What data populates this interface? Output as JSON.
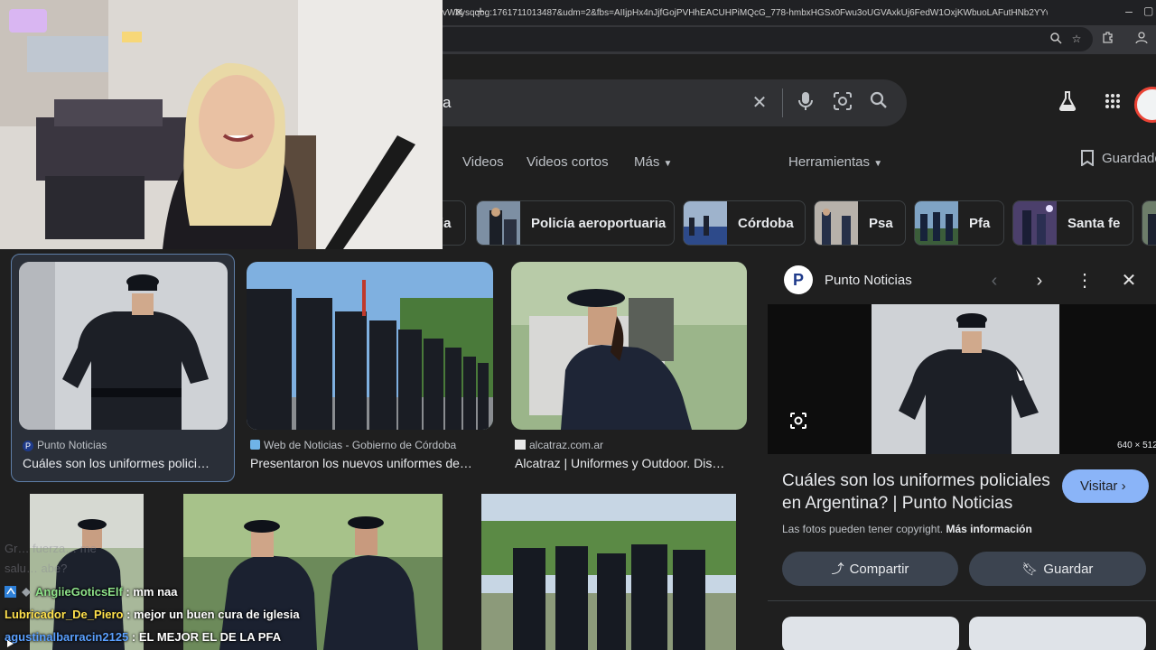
{
  "browser": {
    "url": "vW0ysqqog:1761711013487&udm=2&fbs=AIIjpHx4nJjfGojPVHhEACUHPiMQcG_778-hmbxHGSx0Fwu3oUGVAxkUj6FedW1OxjKWbuoLAFutHNb2YYwYtGf...",
    "tab_close_glyph": "✕",
    "new_tab_glyph": "+",
    "minimize_glyph": "–"
  },
  "search": {
    "query": "a"
  },
  "nav": {
    "tabs": [
      "Videos",
      "Videos cortos",
      "Más",
      "Herramientas"
    ],
    "guardado": "Guardado"
  },
  "chips": [
    {
      "label": "ia"
    },
    {
      "label": "Policía aeroportuaria"
    },
    {
      "label": "Córdoba"
    },
    {
      "label": "Psa"
    },
    {
      "label": "Pfa"
    },
    {
      "label": "Santa fe"
    }
  ],
  "results": [
    {
      "source": "Punto Noticias",
      "title": "Cuáles son los uniformes polici…"
    },
    {
      "source": "Web de Noticias - Gobierno de Córdoba",
      "title": "Presentaron los nuevos uniformes de…"
    },
    {
      "source": "alcatraz.com.ar",
      "title": "Alcatraz | Uniformes y Outdoor. Dis…"
    }
  ],
  "panel": {
    "source": "Punto Noticias",
    "source_initial": "P",
    "dimensions": "640 × 512",
    "title": "Cuáles son los uniformes policiales en Argentina? | Punto Noticias",
    "visit_label": "Visitar",
    "copyright_text": "Las fotos pueden tener copyright.",
    "copyright_link": "Más información",
    "share_label": "Compartir",
    "save_label": "Guardar"
  },
  "chat": {
    "faint": [
      {
        "text": "Gr… fuerza…                                                          me"
      },
      {
        "text": "salu…            abe?"
      }
    ],
    "messages": [
      {
        "user": "AngiieGoticsElf",
        "message": " : mm naa",
        "color": "#8fe38a"
      },
      {
        "user": "Lubricador_De_Piero",
        "message": " : mejor un buen cura de iglesia",
        "color": "#ffe14d"
      },
      {
        "user": "agustinalbarracin2125",
        "message": " : EL MEJOR EL DE LA PFA",
        "color": "#5aa0ff"
      }
    ]
  },
  "colors": {
    "accent": "#8ab4f8",
    "background": "#1f1f1f",
    "chip_border": "#3c4043"
  }
}
